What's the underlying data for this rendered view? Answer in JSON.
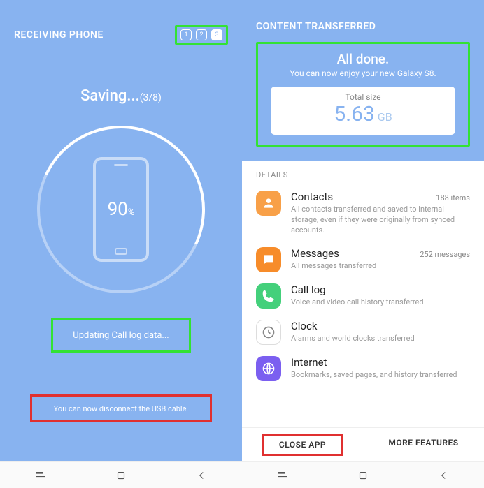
{
  "left": {
    "header_title": "RECEIVING PHONE",
    "steps": [
      "1",
      "2",
      "3"
    ],
    "active_step": 3,
    "saving_label": "Saving...",
    "saving_progress": "(3/8)",
    "percent_value": "90",
    "percent_unit": "%",
    "status_text": "Updating Call log data...",
    "disconnect_text": "You can now disconnect the USB cable."
  },
  "right": {
    "header_title": "CONTENT TRANSFERRED",
    "all_done": "All done.",
    "enjoy": "You can now enjoy your new Galaxy S8.",
    "total_label": "Total size",
    "total_value": "5.63",
    "total_unit": "GB",
    "details_label": "DETAILS",
    "items": [
      {
        "icon": "contacts-icon",
        "color": "bg-orange",
        "title": "Contacts",
        "count": "188 items",
        "desc": "All contacts transferred and saved to internal storage, even if they were originally from synced accounts."
      },
      {
        "icon": "messages-icon",
        "color": "bg-orange2",
        "title": "Messages",
        "count": "252 messages",
        "desc": "All messages transferred"
      },
      {
        "icon": "phone-icon",
        "color": "bg-green",
        "title": "Call log",
        "count": "",
        "desc": "Voice and video call history transferred"
      },
      {
        "icon": "clock-icon",
        "color": "bg-none",
        "title": "Clock",
        "count": "",
        "desc": "Alarms and world clocks transferred"
      },
      {
        "icon": "internet-icon",
        "color": "bg-purple",
        "title": "Internet",
        "count": "",
        "desc": "Bookmarks, saved pages, and history transferred"
      }
    ],
    "close_label": "CLOSE APP",
    "more_label": "MORE FEATURES"
  }
}
